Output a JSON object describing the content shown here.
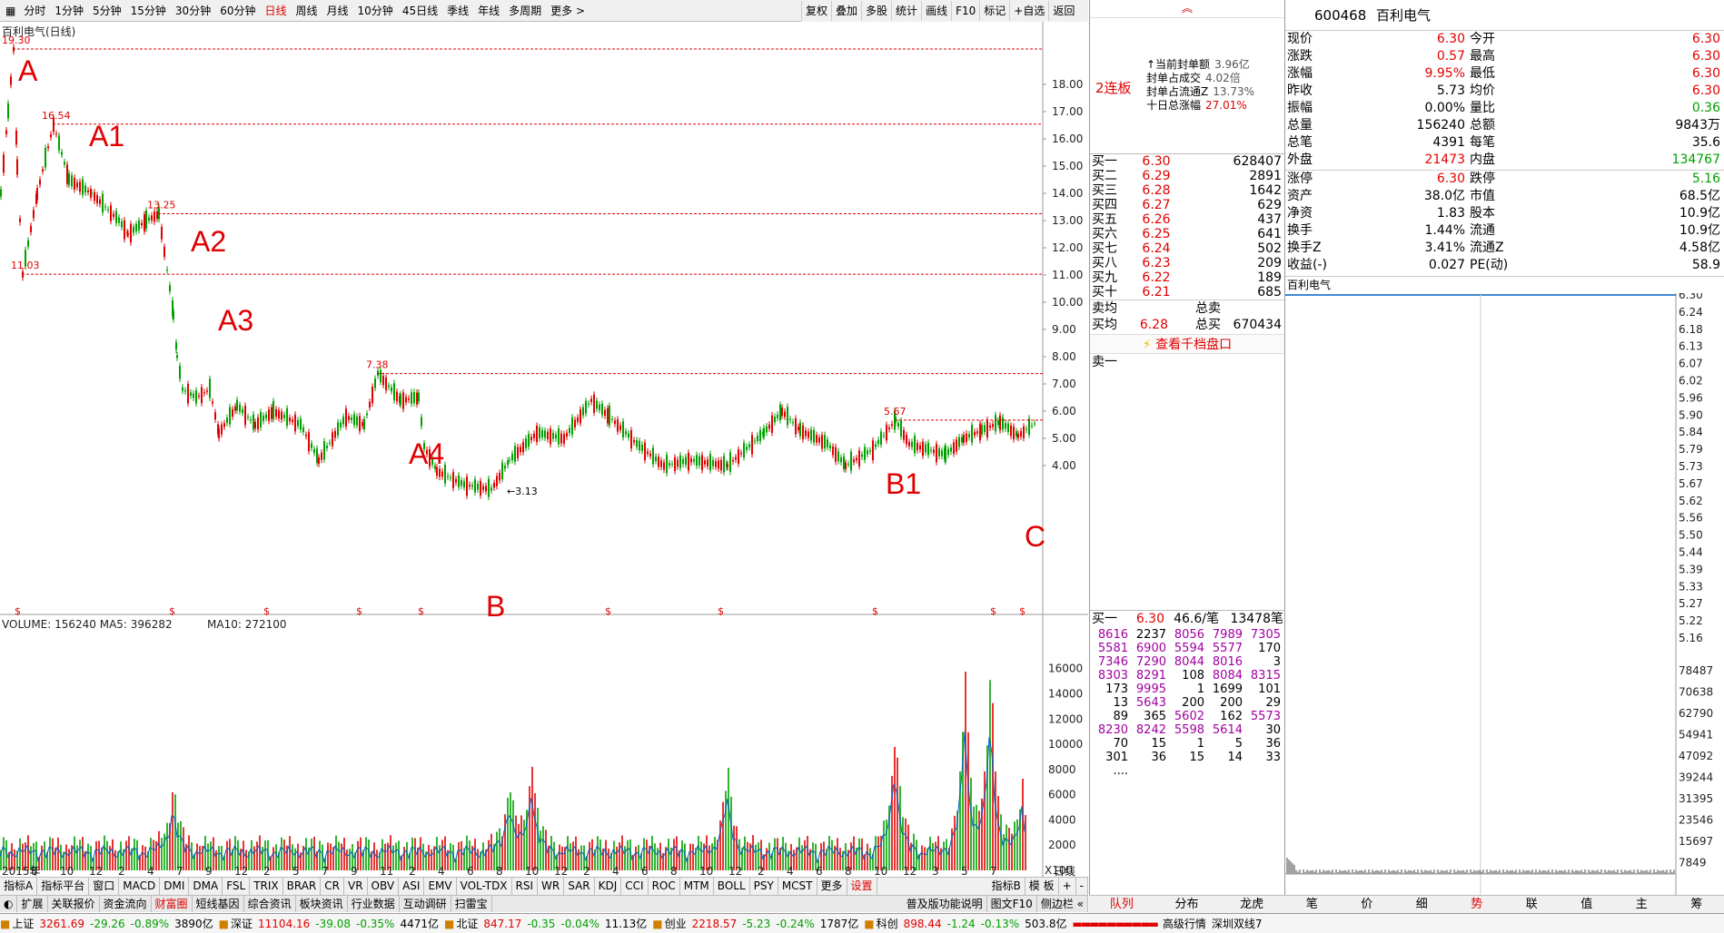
{
  "toolbar": {
    "periods": [
      "分时",
      "1分钟",
      "5分钟",
      "15分钟",
      "30分钟",
      "60分钟",
      "日线",
      "周线",
      "月线",
      "10分钟",
      "45日线",
      "季线",
      "年线",
      "多周期",
      "更多 >"
    ],
    "active_period": "日线",
    "tools": [
      "复权",
      "叠加",
      "多股",
      "统计",
      "画线",
      "F10",
      "标记",
      "+自选",
      "返回"
    ]
  },
  "chart": {
    "stock_title": "百利电气(日线)",
    "price_ticks": [
      "18.00",
      "17.00",
      "16.00",
      "15.00",
      "14.00",
      "13.00",
      "12.00",
      "11.00",
      "10.00",
      "9.00",
      "8.00",
      "7.00",
      "6.00",
      "5.00",
      "4.00"
    ],
    "annotations": [
      {
        "label": "A",
        "price_label": "19.30"
      },
      {
        "label": "A1",
        "price_label": "16.54"
      },
      {
        "label": "A2",
        "price_label": "13.25"
      },
      {
        "label": "A3",
        "price_label": "11.03"
      },
      {
        "label": "A4",
        "price_label": "7.38"
      },
      {
        "label": "B",
        "price_label": "3.13"
      },
      {
        "label": "B1",
        "price_label": "5.67"
      },
      {
        "label": "C",
        "price_label": ""
      }
    ],
    "x_labels": [
      "2015年",
      "8",
      "10",
      "12",
      "2",
      "4",
      "7",
      "9",
      "12",
      "2",
      "5",
      "7",
      "9",
      "11",
      "2",
      "4",
      "6",
      "8",
      "10",
      "12",
      "2",
      "4",
      "6",
      "8",
      "10",
      "12",
      "2",
      "4",
      "6",
      "8",
      "10",
      "12",
      "3",
      "5",
      "7"
    ],
    "bottom_right_label": "日线",
    "volume_title": "VOLUME: 156240  MA5: 396282",
    "volume_ma10": "MA10: 272100",
    "volume_ticks": [
      "16000",
      "14000",
      "12000",
      "10000",
      "8000",
      "6000",
      "4000",
      "2000"
    ],
    "volume_unit": "X100"
  },
  "indicator_tabs": [
    "指标A",
    "指标平台",
    "窗口",
    "MACD",
    "DMI",
    "DMA",
    "FSL",
    "TRIX",
    "BRAR",
    "CR",
    "VR",
    "OBV",
    "ASI",
    "EMV",
    "VOL-TDX",
    "RSI",
    "WR",
    "SAR",
    "KDJ",
    "CCI",
    "ROC",
    "MTM",
    "BOLL",
    "PSY",
    "MCST",
    "更多",
    "设置"
  ],
  "indicator_tabs_right": [
    "指标B",
    "模 板",
    "+",
    "-"
  ],
  "sub_tabs": [
    "扩展",
    "关联报价",
    "资金流向",
    "财富圈",
    "短线基因",
    "综合资讯",
    "板块资讯",
    "行业数据",
    "互动调研",
    "扫雷宝"
  ],
  "sub_tabs_right": [
    "普及版功能说明",
    "图文F10",
    "侧边栏 «"
  ],
  "status": {
    "sh_label": "上证",
    "sh_val": "3261.69",
    "sh_chg": "-29.26",
    "sh_pct": "-0.89%",
    "sh_amt": "3890亿",
    "sz_label": "深证",
    "sz_val": "11104.16",
    "sz_chg": "-39.08",
    "sz_pct": "-0.35%",
    "sz_amt": "4471亿",
    "bz_label": "北证",
    "bz_val": "847.17",
    "bz_chg": "-0.35",
    "bz_pct": "-0.04%",
    "bz_amt": "11.13亿",
    "cy_label": "创业",
    "cy_val": "2218.57",
    "cy_chg": "-5.23",
    "cy_pct": "-0.24%",
    "cy_amt": "1787亿",
    "kc_label": "科创",
    "kc_val": "898.44",
    "kc_chg": "-1.24",
    "kc_pct": "-0.13%",
    "kc_amt": "503.8亿",
    "feed": "高级行情",
    "server": "深圳双线7"
  },
  "mid": {
    "board_label": "2连板",
    "board_info": [
      {
        "k": "↑当前封单额",
        "v": "3.96亿"
      },
      {
        "k": "封单占成交",
        "v": "4.02倍"
      },
      {
        "k": "封单占流通Z",
        "v": "13.73%"
      },
      {
        "k": "十日总涨幅",
        "v": "27.01%"
      }
    ],
    "bids": [
      {
        "l": "买一",
        "p": "6.30",
        "v": "628407"
      },
      {
        "l": "买二",
        "p": "6.29",
        "v": "2891"
      },
      {
        "l": "买三",
        "p": "6.28",
        "v": "1642"
      },
      {
        "l": "买四",
        "p": "6.27",
        "v": "629"
      },
      {
        "l": "买五",
        "p": "6.26",
        "v": "437"
      },
      {
        "l": "买六",
        "p": "6.25",
        "v": "641"
      },
      {
        "l": "买七",
        "p": "6.24",
        "v": "502"
      },
      {
        "l": "买八",
        "p": "6.23",
        "v": "209"
      },
      {
        "l": "买九",
        "p": "6.22",
        "v": "189"
      },
      {
        "l": "买十",
        "p": "6.21",
        "v": "685"
      }
    ],
    "ask_avg_label": "卖均",
    "total_sell_label": "总卖",
    "bid_avg_label": "买均",
    "bid_avg": "6.28",
    "total_buy_label": "总买",
    "total_buy": "670434",
    "view_depth": "查看千档盘口",
    "ask1_label": "卖一",
    "queue_head": {
      "l": "买一",
      "p": "6.30",
      "avg": "46.6/笔",
      "cnt": "13478笔"
    },
    "queue": [
      [
        "8616",
        "2237",
        "8056",
        "7989",
        "7305"
      ],
      [
        "5581",
        "6900",
        "5594",
        "5577",
        "170"
      ],
      [
        "7346",
        "7290",
        "8044",
        "8016",
        "3"
      ],
      [
        "8303",
        "8291",
        "108",
        "8084",
        "8315"
      ],
      [
        "173",
        "9995",
        "1",
        "1699",
        "101"
      ],
      [
        "13",
        "5643",
        "200",
        "200",
        "29"
      ],
      [
        "89",
        "365",
        "5602",
        "162",
        "5573"
      ],
      [
        "8230",
        "8242",
        "5598",
        "5614",
        "30"
      ],
      [
        "70",
        "15",
        "1",
        "5",
        "36"
      ],
      [
        "301",
        "36",
        "15",
        "14",
        "33"
      ],
      [
        "....",
        "",
        "",
        "",
        ""
      ]
    ],
    "tabs": [
      "队列",
      "分布",
      "龙虎"
    ]
  },
  "right": {
    "code": "600468",
    "name": "百利电气",
    "rows": [
      {
        "l": "现价",
        "v": "6.30",
        "l2": "今开",
        "v2": "6.30"
      },
      {
        "l": "涨跌",
        "v": "0.57",
        "l2": "最高",
        "v2": "6.30"
      },
      {
        "l": "涨幅",
        "v": "9.95%",
        "l2": "最低",
        "v2": "6.30"
      },
      {
        "l": "昨收",
        "v": "5.73",
        "l2": "均价",
        "v2": "6.30"
      },
      {
        "l": "振幅",
        "v": "0.00%",
        "l2": "量比",
        "v2": "0.36"
      },
      {
        "l": "总量",
        "v": "156240",
        "l2": "总额",
        "v2": "9843万"
      },
      {
        "l": "总笔",
        "v": "4391",
        "l2": "每笔",
        "v2": "35.6"
      },
      {
        "l": "外盘",
        "v": "21473",
        "l2": "内盘",
        "v2": "134767"
      }
    ],
    "rows2": [
      {
        "l": "涨停",
        "v": "6.30",
        "l2": "跌停",
        "v2": "5.16"
      },
      {
        "l": "资产",
        "v": "38.0亿",
        "l2": "市值",
        "v2": "68.5亿"
      },
      {
        "l": "净资",
        "v": "1.83",
        "l2": "股本",
        "v2": "10.9亿"
      },
      {
        "l": "换手",
        "v": "1.44%",
        "l2": "流通",
        "v2": "10.9亿"
      },
      {
        "l": "换手Z",
        "v": "3.41%",
        "l2": "流通Z",
        "v2": "4.58亿"
      },
      {
        "l": "收益(-)",
        "v": "0.027",
        "l2": "PE(动)",
        "v2": "58.9"
      }
    ],
    "mini_title": "百利电气",
    "mini_price_ticks": [
      "6.30",
      "6.24",
      "6.18",
      "6.13",
      "6.07",
      "6.02",
      "5.96",
      "5.90",
      "5.84",
      "5.79",
      "5.73",
      "5.67",
      "5.62",
      "5.56",
      "5.50",
      "5.44",
      "5.39",
      "5.33",
      "5.27",
      "5.22",
      "5.16"
    ],
    "mini_vol_ticks": [
      "78487",
      "70638",
      "62790",
      "54941",
      "47092",
      "39244",
      "31395",
      "23546",
      "15697",
      "7849"
    ],
    "tabs": [
      "笔",
      "价",
      "细",
      "势",
      "联",
      "值",
      "主",
      "筹"
    ]
  },
  "colors": {
    "up": "#e00000",
    "down": "#00a000",
    "accent": "#e00000",
    "ma": "#0060c0"
  }
}
